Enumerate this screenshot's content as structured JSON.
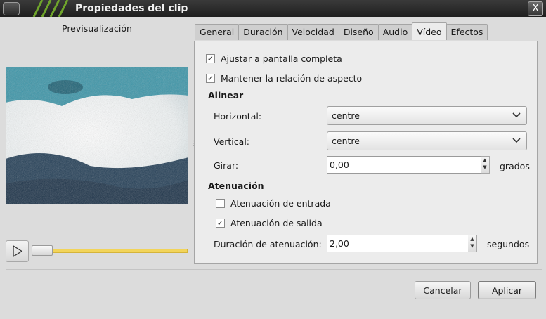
{
  "window": {
    "title": "Propiedades del clip",
    "close_glyph": "X"
  },
  "preview": {
    "label": "Previsualización",
    "play_icon": "play-icon",
    "position": 0
  },
  "tabs": [
    {
      "label": "General"
    },
    {
      "label": "Duración"
    },
    {
      "label": "Velocidad"
    },
    {
      "label": "Diseño"
    },
    {
      "label": "Audio"
    },
    {
      "label": "Vídeo",
      "active": true
    },
    {
      "label": "Efectos"
    }
  ],
  "video": {
    "fit_fullscreen": {
      "label": "Ajustar a pantalla completa",
      "checked": true
    },
    "keep_aspect": {
      "label": "Mantener la relación de aspecto",
      "checked": true
    },
    "align_heading": "Alinear",
    "horizontal": {
      "label": "Horizontal:",
      "value": "centre"
    },
    "vertical": {
      "label": "Vertical:",
      "value": "centre"
    },
    "rotate": {
      "label": "Girar:",
      "value": "0,00",
      "unit": "grados"
    },
    "fade_heading": "Atenuación",
    "fade_in": {
      "label": "Atenuación de entrada",
      "checked": false
    },
    "fade_out": {
      "label": "Atenuación de salida",
      "checked": true
    },
    "fade_duration": {
      "label": "Duración de atenuación:",
      "value": "2,00",
      "unit": "segundos"
    }
  },
  "buttons": {
    "cancel": "Cancelar",
    "apply": "Aplicar"
  },
  "colors": {
    "slider_track": "#f2d45a",
    "titlebar": "#2a2a2a"
  }
}
